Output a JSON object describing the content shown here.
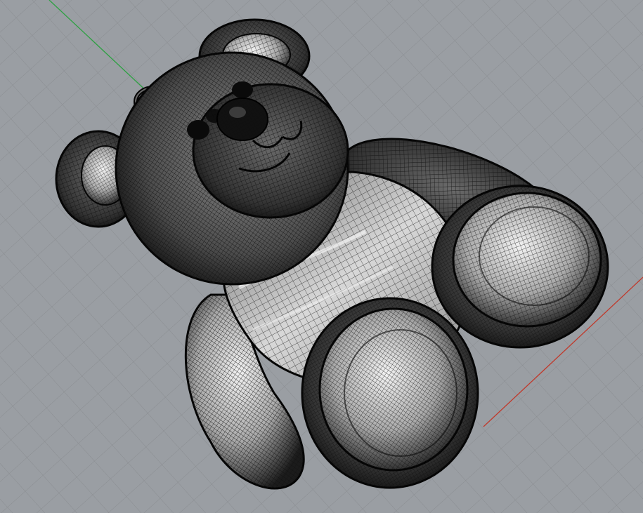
{
  "viewport": {
    "background_color": "#9a9ea3",
    "grid_color": "#86898d",
    "grid_major_color": "#7c7f83",
    "x_axis_color": "#c0392b",
    "y_axis_color": "#2ea043",
    "display_mode": "wireframe-mesh"
  },
  "model": {
    "subject": "teddy bear",
    "base_color": "#5a5a5a",
    "highlight_color": "#e8e8e8",
    "mesh_color": "#111111",
    "parts": [
      "head",
      "left-ear",
      "right-ear",
      "muzzle",
      "nose",
      "eyes",
      "mouth",
      "torso",
      "left-arm",
      "right-arm",
      "left-leg",
      "right-leg",
      "left-foot",
      "right-foot",
      "hanging-loop"
    ]
  }
}
